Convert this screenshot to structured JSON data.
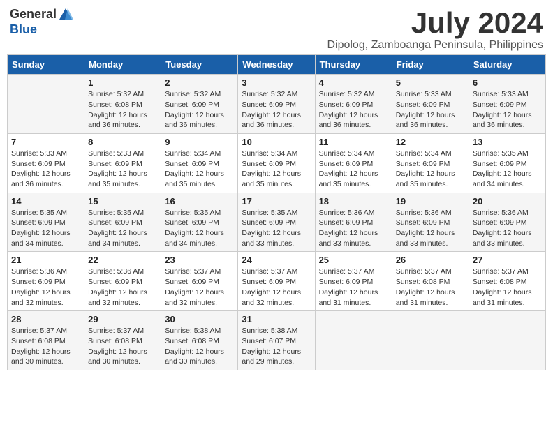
{
  "header": {
    "logo_general": "General",
    "logo_blue": "Blue",
    "month_title": "July 2024",
    "location": "Dipolog, Zamboanga Peninsula, Philippines"
  },
  "days_of_week": [
    "Sunday",
    "Monday",
    "Tuesday",
    "Wednesday",
    "Thursday",
    "Friday",
    "Saturday"
  ],
  "weeks": [
    [
      {
        "day": "",
        "info": ""
      },
      {
        "day": "1",
        "info": "Sunrise: 5:32 AM\nSunset: 6:08 PM\nDaylight: 12 hours\nand 36 minutes."
      },
      {
        "day": "2",
        "info": "Sunrise: 5:32 AM\nSunset: 6:09 PM\nDaylight: 12 hours\nand 36 minutes."
      },
      {
        "day": "3",
        "info": "Sunrise: 5:32 AM\nSunset: 6:09 PM\nDaylight: 12 hours\nand 36 minutes."
      },
      {
        "day": "4",
        "info": "Sunrise: 5:32 AM\nSunset: 6:09 PM\nDaylight: 12 hours\nand 36 minutes."
      },
      {
        "day": "5",
        "info": "Sunrise: 5:33 AM\nSunset: 6:09 PM\nDaylight: 12 hours\nand 36 minutes."
      },
      {
        "day": "6",
        "info": "Sunrise: 5:33 AM\nSunset: 6:09 PM\nDaylight: 12 hours\nand 36 minutes."
      }
    ],
    [
      {
        "day": "7",
        "info": "Sunrise: 5:33 AM\nSunset: 6:09 PM\nDaylight: 12 hours\nand 36 minutes."
      },
      {
        "day": "8",
        "info": "Sunrise: 5:33 AM\nSunset: 6:09 PM\nDaylight: 12 hours\nand 35 minutes."
      },
      {
        "day": "9",
        "info": "Sunrise: 5:34 AM\nSunset: 6:09 PM\nDaylight: 12 hours\nand 35 minutes."
      },
      {
        "day": "10",
        "info": "Sunrise: 5:34 AM\nSunset: 6:09 PM\nDaylight: 12 hours\nand 35 minutes."
      },
      {
        "day": "11",
        "info": "Sunrise: 5:34 AM\nSunset: 6:09 PM\nDaylight: 12 hours\nand 35 minutes."
      },
      {
        "day": "12",
        "info": "Sunrise: 5:34 AM\nSunset: 6:09 PM\nDaylight: 12 hours\nand 35 minutes."
      },
      {
        "day": "13",
        "info": "Sunrise: 5:35 AM\nSunset: 6:09 PM\nDaylight: 12 hours\nand 34 minutes."
      }
    ],
    [
      {
        "day": "14",
        "info": "Sunrise: 5:35 AM\nSunset: 6:09 PM\nDaylight: 12 hours\nand 34 minutes."
      },
      {
        "day": "15",
        "info": "Sunrise: 5:35 AM\nSunset: 6:09 PM\nDaylight: 12 hours\nand 34 minutes."
      },
      {
        "day": "16",
        "info": "Sunrise: 5:35 AM\nSunset: 6:09 PM\nDaylight: 12 hours\nand 34 minutes."
      },
      {
        "day": "17",
        "info": "Sunrise: 5:35 AM\nSunset: 6:09 PM\nDaylight: 12 hours\nand 33 minutes."
      },
      {
        "day": "18",
        "info": "Sunrise: 5:36 AM\nSunset: 6:09 PM\nDaylight: 12 hours\nand 33 minutes."
      },
      {
        "day": "19",
        "info": "Sunrise: 5:36 AM\nSunset: 6:09 PM\nDaylight: 12 hours\nand 33 minutes."
      },
      {
        "day": "20",
        "info": "Sunrise: 5:36 AM\nSunset: 6:09 PM\nDaylight: 12 hours\nand 33 minutes."
      }
    ],
    [
      {
        "day": "21",
        "info": "Sunrise: 5:36 AM\nSunset: 6:09 PM\nDaylight: 12 hours\nand 32 minutes."
      },
      {
        "day": "22",
        "info": "Sunrise: 5:36 AM\nSunset: 6:09 PM\nDaylight: 12 hours\nand 32 minutes."
      },
      {
        "day": "23",
        "info": "Sunrise: 5:37 AM\nSunset: 6:09 PM\nDaylight: 12 hours\nand 32 minutes."
      },
      {
        "day": "24",
        "info": "Sunrise: 5:37 AM\nSunset: 6:09 PM\nDaylight: 12 hours\nand 32 minutes."
      },
      {
        "day": "25",
        "info": "Sunrise: 5:37 AM\nSunset: 6:09 PM\nDaylight: 12 hours\nand 31 minutes."
      },
      {
        "day": "26",
        "info": "Sunrise: 5:37 AM\nSunset: 6:08 PM\nDaylight: 12 hours\nand 31 minutes."
      },
      {
        "day": "27",
        "info": "Sunrise: 5:37 AM\nSunset: 6:08 PM\nDaylight: 12 hours\nand 31 minutes."
      }
    ],
    [
      {
        "day": "28",
        "info": "Sunrise: 5:37 AM\nSunset: 6:08 PM\nDaylight: 12 hours\nand 30 minutes."
      },
      {
        "day": "29",
        "info": "Sunrise: 5:37 AM\nSunset: 6:08 PM\nDaylight: 12 hours\nand 30 minutes."
      },
      {
        "day": "30",
        "info": "Sunrise: 5:38 AM\nSunset: 6:08 PM\nDaylight: 12 hours\nand 30 minutes."
      },
      {
        "day": "31",
        "info": "Sunrise: 5:38 AM\nSunset: 6:07 PM\nDaylight: 12 hours\nand 29 minutes."
      },
      {
        "day": "",
        "info": ""
      },
      {
        "day": "",
        "info": ""
      },
      {
        "day": "",
        "info": ""
      }
    ]
  ]
}
